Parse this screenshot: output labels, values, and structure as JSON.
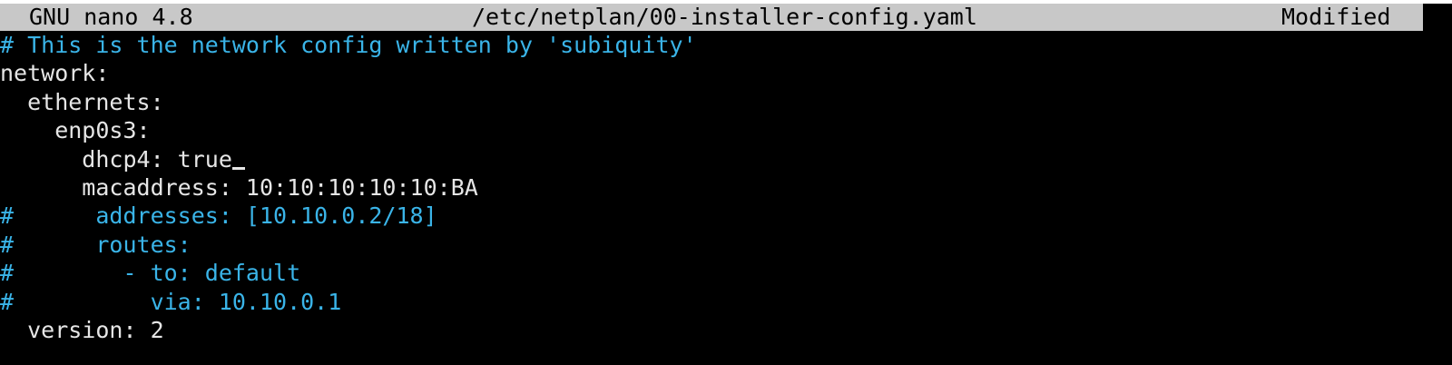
{
  "titlebar": {
    "app": "GNU nano 4.8",
    "file": "/etc/netplan/00-installer-config.yaml",
    "status": "Modified"
  },
  "colors": {
    "comment": "#3ab4e8",
    "text": "#e6e6e6",
    "background": "#000000",
    "titlebar": "#c8c8c8"
  },
  "editor": {
    "lines": [
      {
        "text": "# This is the network config written by 'subiquity'",
        "kind": "comment"
      },
      {
        "text": "network:",
        "kind": "plain"
      },
      {
        "text": "  ethernets:",
        "kind": "plain"
      },
      {
        "text": "    enp0s3:",
        "kind": "plain"
      },
      {
        "text": "      dhcp4: true",
        "kind": "plain",
        "cursor": true
      },
      {
        "text": "      macaddress: 10:10:10:10:10:BA",
        "kind": "plain"
      },
      {
        "text": "#      addresses: [10.10.0.2/18]",
        "kind": "comment"
      },
      {
        "text": "#      routes:",
        "kind": "comment"
      },
      {
        "text": "#        - to: default",
        "kind": "comment"
      },
      {
        "text": "#          via: 10.10.0.1",
        "kind": "comment"
      },
      {
        "text": "  version: 2",
        "kind": "plain"
      }
    ]
  }
}
